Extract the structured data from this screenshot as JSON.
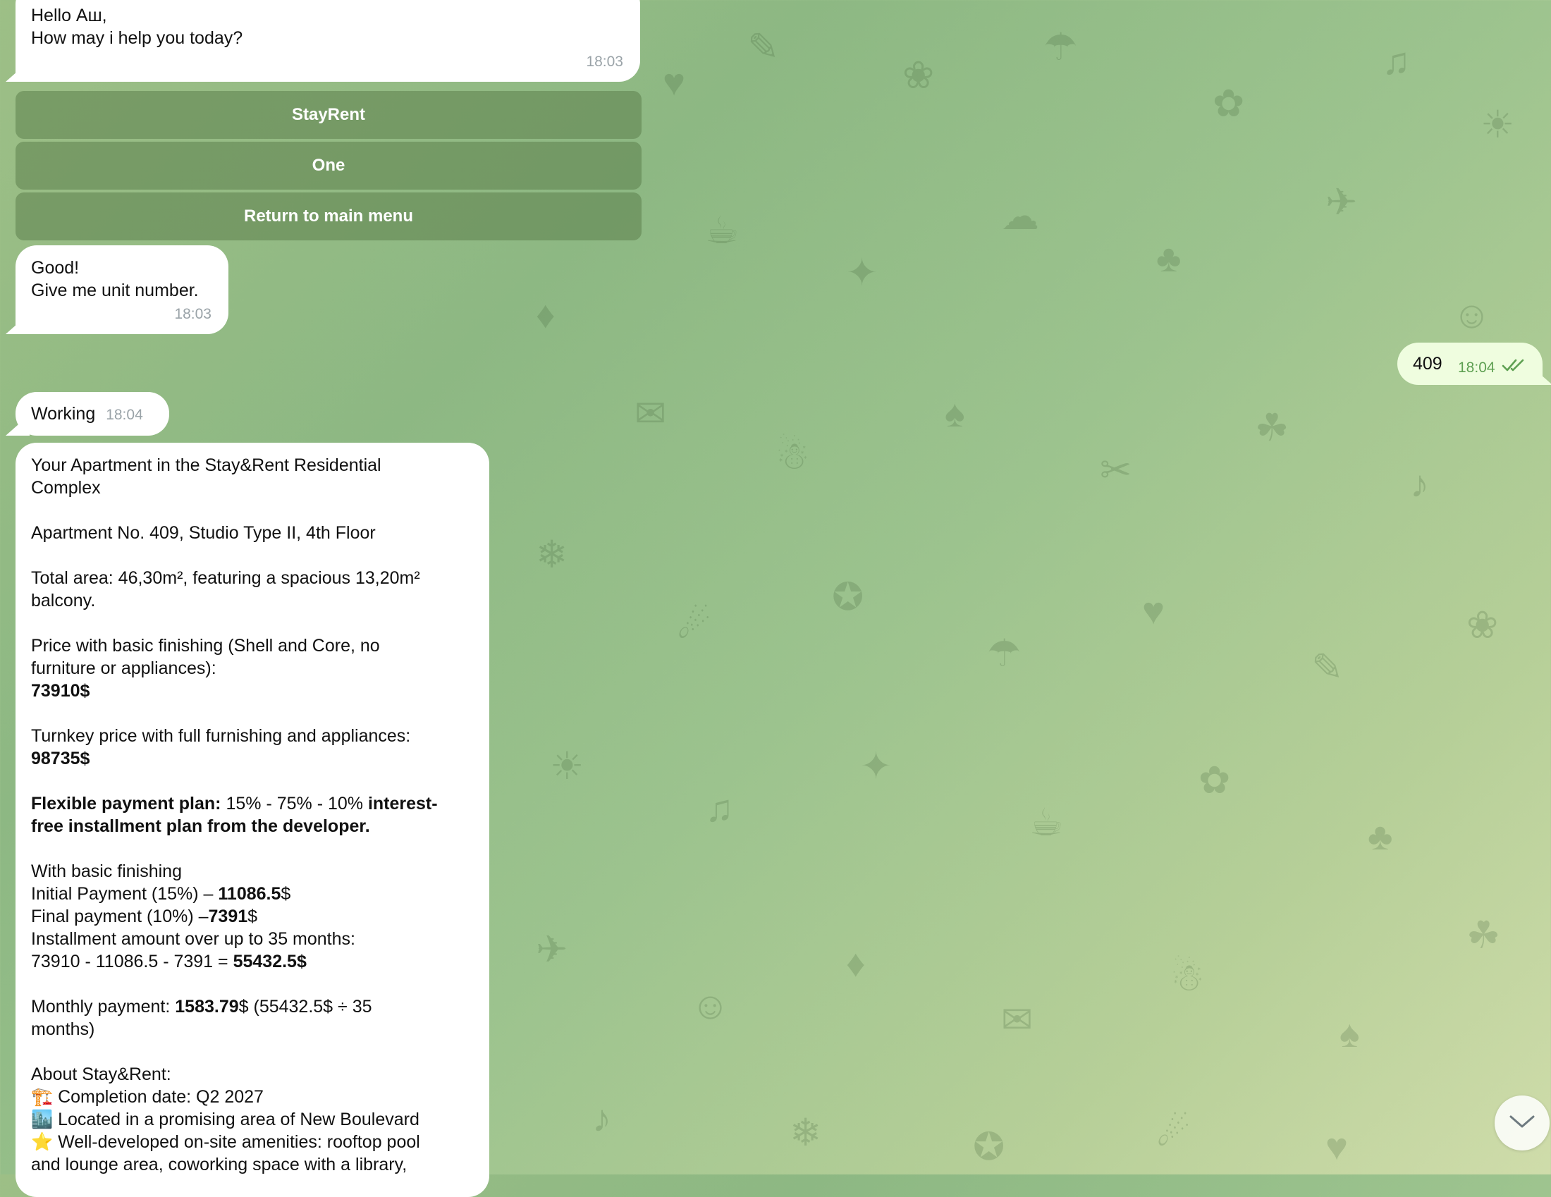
{
  "colors": {
    "incoming_bubble": "#ffffff",
    "outgoing_bubble": "#effddf",
    "keyboard_button": "#5c804c",
    "read_checkmark": "#5ea052"
  },
  "messages": {
    "greeting": {
      "line1": "Hello Аш,",
      "line2": "How may i help you today?",
      "time": "18:03"
    },
    "keyboard": {
      "btn1": "StayRent",
      "btn2": "One",
      "btn3": "Return to main menu"
    },
    "prompt": {
      "line1": "Good!",
      "line2": "Give me unit number.",
      "time": "18:03"
    },
    "reply": {
      "text": "409",
      "time": "18:04",
      "status_icon": "double-check-icon"
    },
    "working": {
      "text": "Working",
      "time": "18:04"
    },
    "apartment": {
      "title_1": "Your Apartment in the Stay&Rent Residential",
      "title_2": "Complex",
      "unit": "Apartment No. 409, Studio Type II, 4th Floor",
      "area_1": "Total area: 46,30m², featuring a spacious 13,20m²",
      "area_2": "balcony.",
      "basic_1": "Price with basic finishing (Shell and Core, no",
      "basic_2": "furniture or appliances):",
      "basic_price": "73910$",
      "turnkey_1": "Turnkey price with full furnishing and appliances:",
      "turnkey_price": "98735$",
      "plan_label": "Flexible payment plan:",
      "plan_split": " 15% - 75% - 10% ",
      "plan_bold_1": "interest-",
      "plan_bold_2": "free installment plan from the developer.",
      "wb_heading": "With basic finishing",
      "initial_label": "Initial Payment (15%) – ",
      "initial_value": "11086.5",
      "initial_unit": "$",
      "final_label": "Final payment (10%) –",
      "final_value": "7391",
      "final_unit": "$",
      "install_label": "Installment amount over up to 35 months:",
      "install_calc": "73910 - 11086.5 - 7391 = ",
      "install_value": "55432.5$",
      "monthly_label": "Monthly payment: ",
      "monthly_value": "1583.79",
      "monthly_rest": "$ (55432.5$ ÷ 35",
      "monthly_rest_2": "months)",
      "about_heading": "About Stay&Rent:",
      "about_1_icon": "🏗️",
      "about_1": " Completion date: Q2 2027",
      "about_2_icon": "🏙️",
      "about_2": " Located in a promising area of New Boulevard",
      "about_3_icon": "⭐",
      "about_3": " Well-developed on-site amenities: rooftop pool",
      "about_3b": "and lounge area, coworking space with a library,"
    }
  },
  "scroll_button": {
    "icon": "chevron-down-icon"
  }
}
